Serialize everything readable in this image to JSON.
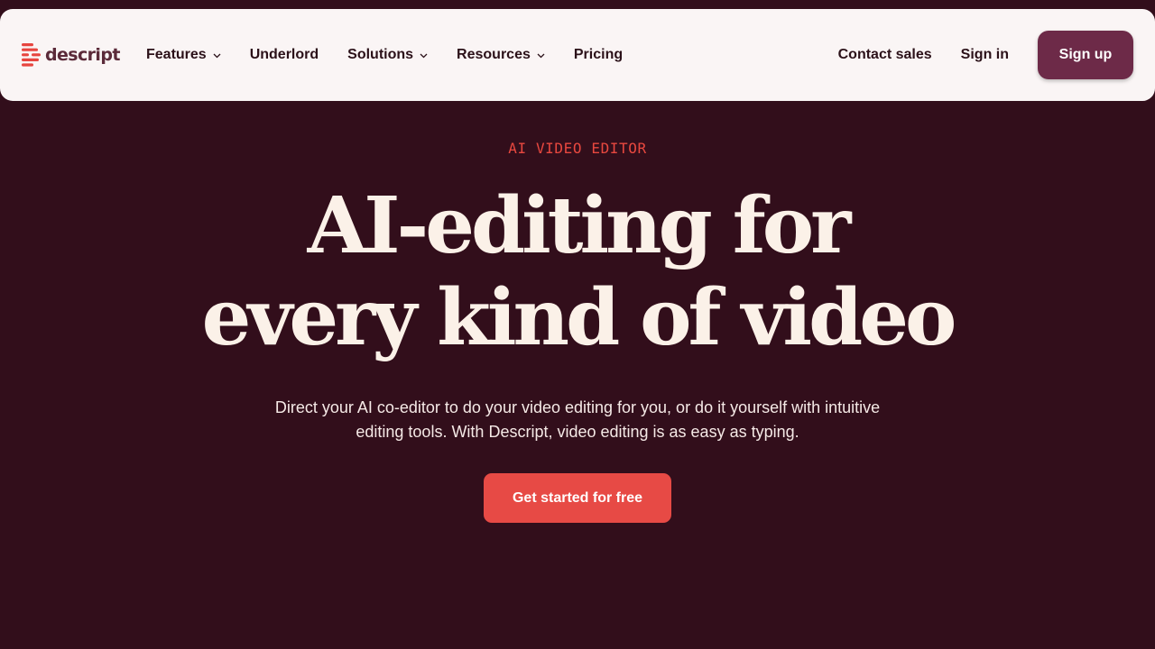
{
  "brand": {
    "name": "descript",
    "logo_icon": "descript-logo-icon",
    "colors": {
      "logo_red": "#e7453f",
      "logo_text": "#5b2a39"
    }
  },
  "nav": {
    "items": [
      {
        "label": "Features",
        "has_dropdown": true
      },
      {
        "label": "Underlord",
        "has_dropdown": false
      },
      {
        "label": "Solutions",
        "has_dropdown": true
      },
      {
        "label": "Resources",
        "has_dropdown": true
      },
      {
        "label": "Pricing",
        "has_dropdown": false
      }
    ],
    "contact_sales": "Contact sales",
    "sign_in": "Sign in",
    "sign_up": "Sign up"
  },
  "hero": {
    "eyebrow": "AI VIDEO EDITOR",
    "headline_line1": "AI-editing for",
    "headline_line2": "every kind of video",
    "subtext": "Direct your AI co-editor to do your video editing for you, or do it yourself with intuitive editing tools. With Descript, video editing is as easy as typing.",
    "cta": "Get started for free"
  },
  "colors": {
    "background": "#320e1b",
    "navbar_bg": "#faf5f5",
    "accent_red": "#e74a45",
    "signup_bg": "#6d2a48",
    "headline_text": "#fbf1e8"
  }
}
